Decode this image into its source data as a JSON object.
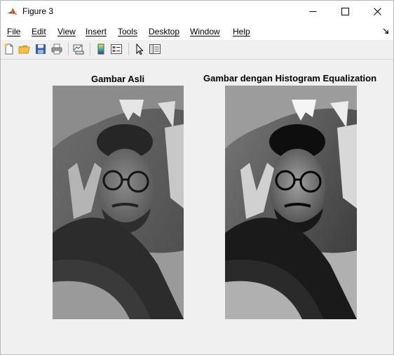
{
  "window": {
    "title": "Figure 3"
  },
  "menu": {
    "items": [
      {
        "label": "File"
      },
      {
        "label": "Edit"
      },
      {
        "label": "View"
      },
      {
        "label": "Insert"
      },
      {
        "label": "Tools"
      },
      {
        "label": "Desktop"
      },
      {
        "label": "Window"
      },
      {
        "label": "Help"
      }
    ]
  },
  "toolbar": {
    "icons": [
      "new-figure-icon",
      "open-file-icon",
      "save-icon",
      "print-icon",
      "link-plot-icon",
      "colorbar-icon",
      "legend-icon",
      "edit-plot-pointer-icon",
      "property-inspector-icon"
    ]
  },
  "axes": [
    {
      "title": "Gambar Asli"
    },
    {
      "title": "Gambar dengan Histogram Equalization"
    }
  ],
  "colors": {
    "background": "#f0f0f0",
    "titlebar": "#ffffff",
    "matlab_orange": "#e8762b"
  }
}
